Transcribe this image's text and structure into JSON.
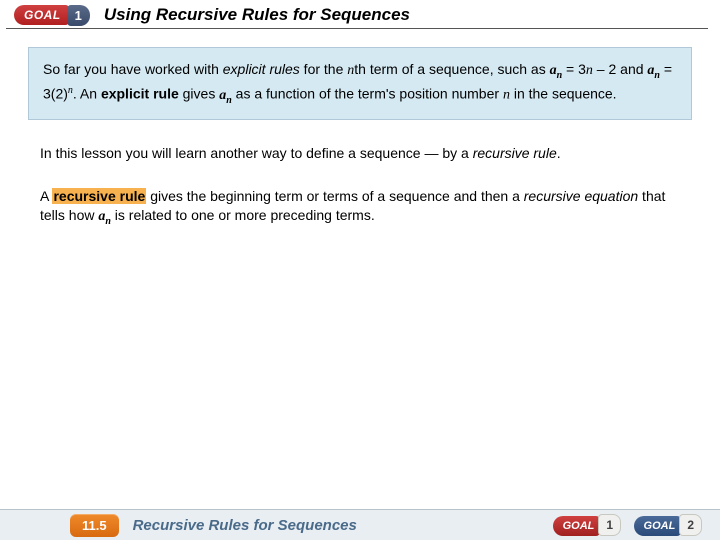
{
  "header": {
    "goal_label": "GOAL",
    "goal_number": "1",
    "title": "Using Recursive Rules for Sequences"
  },
  "bluebox": {
    "t1": "So far you have worked with ",
    "t2": "explicit rules",
    "t3": " for the ",
    "t4": "n",
    "t5": "th",
    "t6": " term of a sequence, such as ",
    "t7": "a",
    "t8": "n",
    "t9": " = 3",
    "t10": "n",
    "t11": " – 2 and ",
    "t12": "a",
    "t13": "n",
    "t14": " = 3(2)",
    "t15": "n",
    "t16": ". An ",
    "t17": "explicit rule",
    "t18": " gives ",
    "t19": "a",
    "t20": "n",
    "t21": " as a function of the term's position number ",
    "t22": "n",
    "t23": " in the sequence."
  },
  "para1": {
    "t1": "In this lesson you will learn another way to define a sequence — by a ",
    "t2": "recursive rule",
    "t3": "."
  },
  "para2": {
    "t1": "A ",
    "t2": "recursive rule",
    "t3": " gives the beginning term or terms of a sequence and then a ",
    "t4": "recursive equation",
    "t5": " that tells how ",
    "t6": "a",
    "t7": "n",
    "t8": " is related to one or more preceding terms."
  },
  "footer": {
    "section": "11.5",
    "title": "Recursive Rules for Sequences",
    "goal1_label": "GOAL",
    "goal1_num": "1",
    "goal2_label": "GOAL",
    "goal2_num": "2"
  }
}
